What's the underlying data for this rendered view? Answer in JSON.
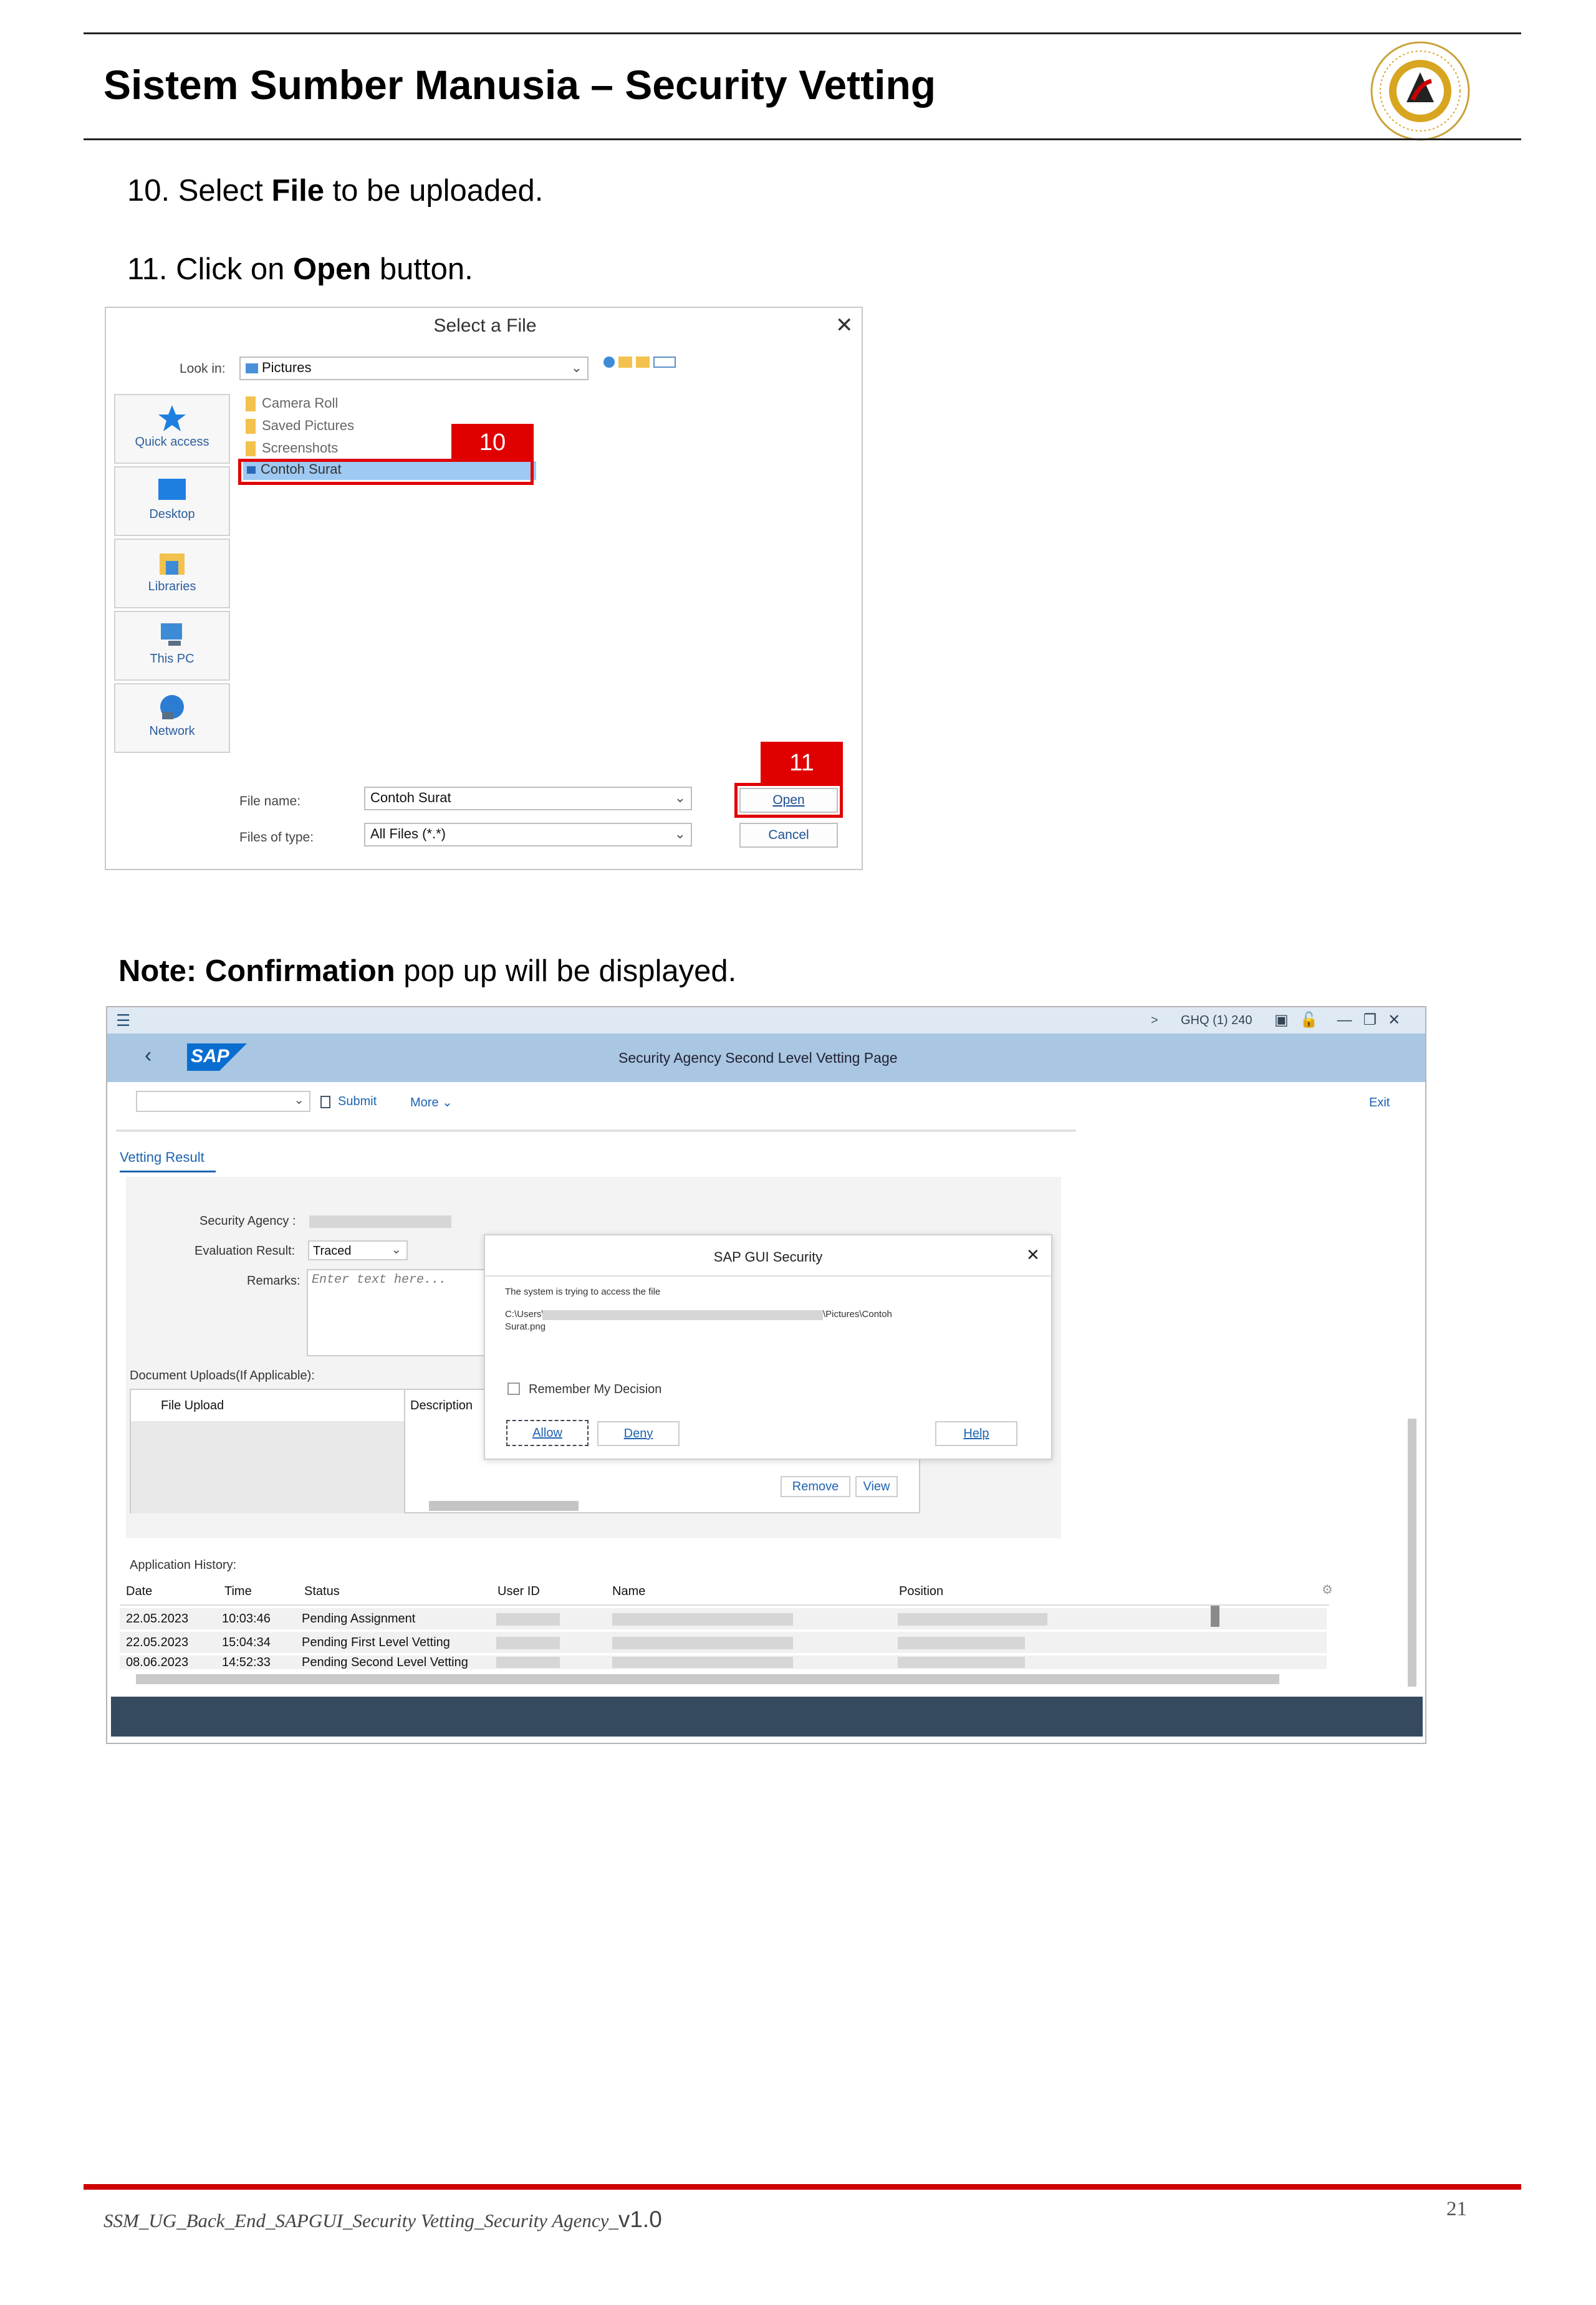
{
  "header": {
    "title": "Sistem Sumber Manusia – Security Vetting",
    "logo_text": "SISTEM SUMBER MANUSIA"
  },
  "steps": [
    {
      "pre": "10. Select ",
      "bold": "File",
      "post": " to be uploaded."
    },
    {
      "pre": "11. Click on ",
      "bold": "Open",
      "post": " button."
    }
  ],
  "file_dialog": {
    "title": "Select a File",
    "close": "✕",
    "look_in_label": "Look in:",
    "look_in_value": "Pictures",
    "places": [
      "Quick access",
      "Desktop",
      "Libraries",
      "This PC",
      "Network"
    ],
    "files": [
      "Camera Roll",
      "Saved Pictures",
      "Screenshots",
      "Contoh Surat"
    ],
    "file_name_label": "File name:",
    "file_name_value": "Contoh Surat",
    "file_type_label": "Files of type:",
    "file_type_value": "All Files (*.*)",
    "open_label": "Open",
    "cancel_label": "Cancel",
    "callout_10": "10",
    "callout_11": "11"
  },
  "note": {
    "bold": "Note: Confirmation",
    "rest": " pop up will be displayed."
  },
  "sap": {
    "system": "GHQ (1) 240",
    "logo": "SAP",
    "page_title": "Security Agency Second Level Vetting Page",
    "submit": "Submit",
    "more": "More",
    "exit": "Exit",
    "tab": "Vetting Result",
    "security_agency_label": "Security Agency :",
    "eval_label": "Evaluation Result:",
    "eval_value": "Traced",
    "remarks_label": "Remarks:",
    "remarks_placeholder": "Enter text here...",
    "doc_uploads_label": "Document Uploads(If Applicable):",
    "col_file_upload": "File Upload",
    "col_description": "Description",
    "remove": "Remove",
    "view": "View",
    "history_label": "Application History:",
    "history_headers": [
      "Date",
      "Time",
      "Status",
      "User ID",
      "Name",
      "Position"
    ],
    "history_rows": [
      {
        "date": "22.05.2023",
        "time": "10:03:46",
        "status": "Pending Assignment"
      },
      {
        "date": "22.05.2023",
        "time": "15:04:34",
        "status": "Pending First Level Vetting"
      },
      {
        "date": "08.06.2023",
        "time": "14:52:33",
        "status": "Pending Second Level Vetting"
      }
    ],
    "popup": {
      "title": "SAP GUI Security",
      "message": "The system is trying to access the file",
      "path_start": "C:\\Users\\",
      "path_end": "\\Pictures\\Contoh",
      "path_line2": "Surat.png",
      "remember": "Remember My Decision",
      "allow": "Allow",
      "deny": "Deny",
      "help": "Help"
    }
  },
  "footer": {
    "doc_name": "SSM_UG_Back_End_SAPGUI_Security Vetting_Security Agency_",
    "version": "v1.0",
    "page_number": "21"
  },
  "colors": {
    "accent_red": "#e00000",
    "sap_header": "#a9c6e2",
    "sap_status_bar": "#354a5f",
    "footer_red": "#cc0000"
  }
}
